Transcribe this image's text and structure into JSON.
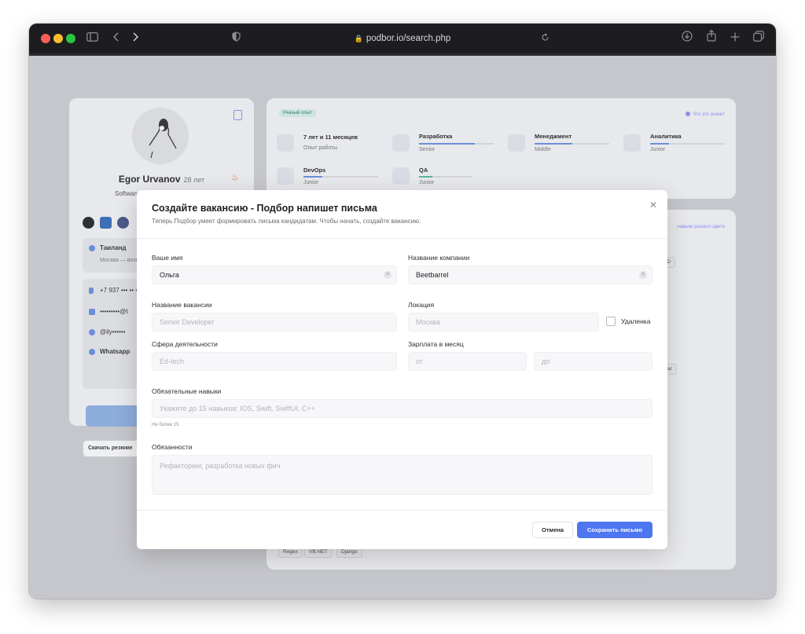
{
  "browser": {
    "url": "podbor.io/search.php"
  },
  "profile": {
    "name": "Egor Urvanov",
    "age": "28 лет",
    "role": "Software Developer",
    "location_city": "Таиланд",
    "location_sub": "Москва — возможен переезд",
    "phone": "+7 937 ••• •• ••",
    "email": "•••••••••@t",
    "telegram": "@ily••••••",
    "whatsapp": "Whatsapp",
    "download_label": "Скачать резюме"
  },
  "experience": {
    "badge": "Реаный опыт",
    "help_link": "Что это значит",
    "total_title": "7 лет и 11 месяцев",
    "total_sub": "Опыт работы",
    "areas": [
      {
        "title": "Разработка",
        "level": "Senior",
        "progress": 0.75
      },
      {
        "title": "Менеджмент",
        "level": "Middle",
        "progress": 0.5
      },
      {
        "title": "Аналитика",
        "level": "Junior",
        "progress": 0.25
      },
      {
        "title": "DevOps",
        "level": "Junior",
        "progress": 0.25
      },
      {
        "title": "QA",
        "level": "Junior",
        "progress": 0.25
      }
    ]
  },
  "skills": {
    "link": "навыки разного цвета",
    "tags_right": [
      "SD",
      "ular"
    ],
    "tags_bottom": [
      "Regex",
      "VB.NET",
      "Django"
    ]
  },
  "modal": {
    "title": "Создайте вакансию - Подбор напишет письма",
    "subtitle": "Теперь Подбор умеет формировать письма кандидатам. Чтобы начать, создайте вакансию.",
    "close_glyph": "✕",
    "name_label": "Ваше имя",
    "name_value": "Ольга",
    "company_label": "Название компании",
    "company_value": "Beetbarrel",
    "vacancy_label": "Название вакансии",
    "vacancy_placeholder": "Senior Developer",
    "location_label": "Локация",
    "location_placeholder": "Москва",
    "remote_label": "Удаленка",
    "sphere_label": "Сфера деятельности",
    "sphere_placeholder": "Ed-tech",
    "salary_label": "Зарплата в месяц",
    "salary_from_placeholder": "от",
    "salary_to_placeholder": "до",
    "skills_label": "Обязательные навыки",
    "skills_placeholder": "Укажите до 15 навыков: IOS, Swift, SwiftUI, C++",
    "skills_hint": "Не более 15",
    "duties_label": "Обязанности",
    "duties_placeholder": "Рефакторинг, разработка новых фич",
    "cancel_label": "Отмена",
    "save_label": "Сохранить письмо"
  },
  "colors": {
    "accent": "#4d76f0",
    "close_red": "#fe5f57",
    "minimize_yellow": "#febc2e",
    "zoom_green": "#28c840"
  }
}
